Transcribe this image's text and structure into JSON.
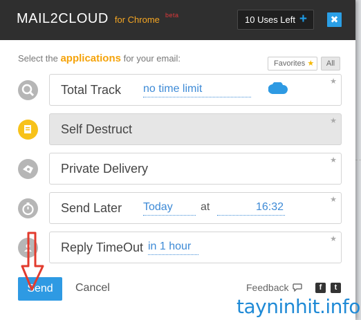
{
  "header": {
    "app_name": "MAIL2CLOUD",
    "subtitle": "for Chrome",
    "beta": "beta",
    "uses_left": "10 Uses Left",
    "close_symbol": "✖"
  },
  "prompt": {
    "prefix": "Select the ",
    "highlight": "applications",
    "suffix": " for your email:"
  },
  "filters": {
    "favorites_label": "Favorites",
    "all_label": "All"
  },
  "apps": [
    {
      "label": "Total Track",
      "value": "no time limit",
      "icon": "search-icon"
    },
    {
      "label": "Self Destruct",
      "icon": "self-destruct-icon"
    },
    {
      "label": "Private Delivery",
      "icon": "eye-icon"
    },
    {
      "label": "Send Later",
      "date": "Today",
      "at": "at",
      "time": "16:32",
      "icon": "stopwatch-icon"
    },
    {
      "label": "Reply TimeOut",
      "value": "in 1 hour",
      "icon": "person-icon"
    }
  ],
  "footer": {
    "send_label": "Send",
    "cancel_label": "Cancel",
    "feedback_label": "Feedback"
  },
  "watermark": "tayninhit.info",
  "colors": {
    "accent_blue": "#2e9ae3",
    "brand_orange": "#f5a623",
    "active_icon": "#f7c21a",
    "arrow_red": "#e23b2e"
  }
}
